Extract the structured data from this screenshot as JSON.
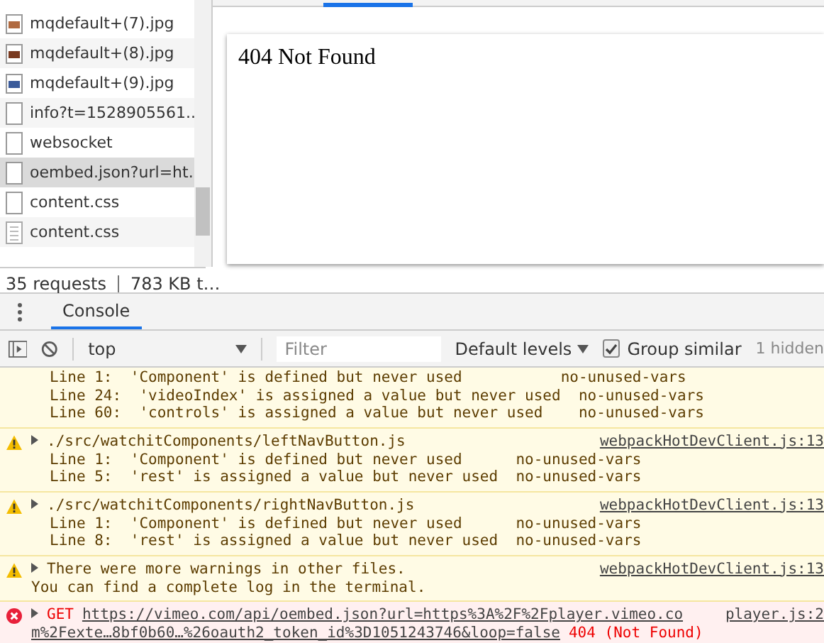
{
  "network": {
    "requests": [
      {
        "name": "mqdefault+(7).jpg",
        "kind": "image",
        "selected": false
      },
      {
        "name": "mqdefault+(8).jpg",
        "kind": "image",
        "selected": false
      },
      {
        "name": "mqdefault+(9).jpg",
        "kind": "image",
        "selected": false
      },
      {
        "name": "info?t=1528905561..",
        "kind": "blank",
        "selected": false
      },
      {
        "name": "websocket",
        "kind": "blank",
        "selected": false
      },
      {
        "name": "oembed.json?url=ht.",
        "kind": "blank",
        "selected": true
      },
      {
        "name": "content.css",
        "kind": "blank",
        "selected": false
      },
      {
        "name": "content.css",
        "kind": "document",
        "selected": false
      }
    ],
    "summary": [
      "35 requests",
      "783 KB t…"
    ]
  },
  "preview": {
    "heading": "404 Not Found"
  },
  "drawer": {
    "tabs": [
      {
        "label": "Console",
        "selected": true
      }
    ]
  },
  "toolbar": {
    "context": "top",
    "filter": {
      "placeholder": "Filter"
    },
    "levels": "Default levels",
    "group_similar": {
      "label": "Group similar",
      "checked": true
    },
    "hidden": "1 hidden"
  },
  "log": [
    {
      "kind": "warning",
      "lines": [
        "Line 1:  'Component' is defined but never used           no-unused-vars",
        "Line 24:  'videoIndex' is assigned a value but never used  no-unused-vars",
        "Line 60:  'controls' is assigned a value but never used    no-unused-vars"
      ]
    },
    {
      "kind": "warning",
      "message": "./src/watchitComponents/leftNavButton.js",
      "source": "webpackHotDevClient.js:13",
      "lines": [
        "Line 1:  'Component' is defined but never used      no-unused-vars",
        "Line 5:  'rest' is assigned a value but never used  no-unused-vars"
      ]
    },
    {
      "kind": "warning",
      "message": "./src/watchitComponents/rightNavButton.js",
      "source": "webpackHotDevClient.js:13",
      "lines": [
        "Line 1:  'Component' is defined but never used      no-unused-vars",
        "Line 8:  'rest' is assigned a value but never used  no-unused-vars"
      ]
    },
    {
      "kind": "warning",
      "message": "There were more warnings in other files.",
      "source": "webpackHotDevClient.js:13",
      "plain_lines": [
        "You can find a complete log in the terminal."
      ]
    },
    {
      "kind": "error",
      "method": "GET",
      "url_parts": [
        "https://vimeo.com/api/oembed.json?url=https%3A%2F%2Fplayer.vimeo.co",
        "m%2Fexte…8bf0b60…%26oauth2_token_id%3D1051243746&loop=false"
      ],
      "status": "404 (Not Found)",
      "source": "player.js:2"
    }
  ]
}
